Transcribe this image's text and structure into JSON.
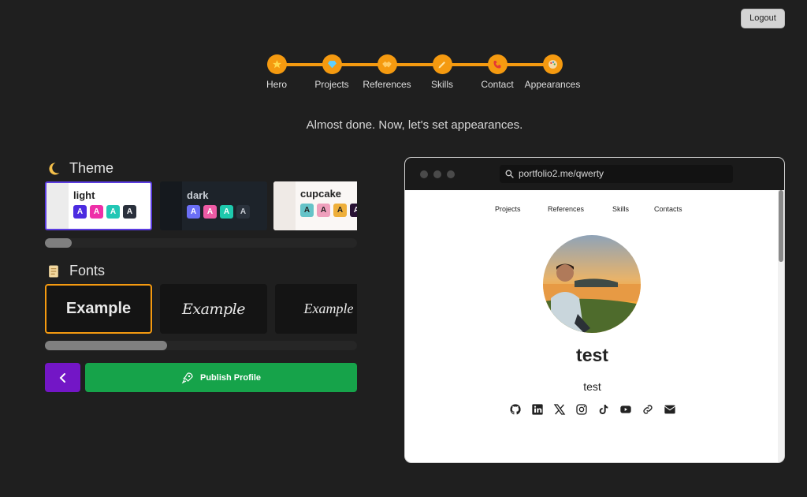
{
  "header": {
    "logout_label": "Logout"
  },
  "stepper": {
    "steps": [
      {
        "label": "Hero",
        "icon": "star-icon"
      },
      {
        "label": "Projects",
        "icon": "gem-icon"
      },
      {
        "label": "References",
        "icon": "handshake-icon"
      },
      {
        "label": "Skills",
        "icon": "pencil-icon"
      },
      {
        "label": "Contact",
        "icon": "phone-icon"
      },
      {
        "label": "Appearances",
        "icon": "palette-icon"
      }
    ],
    "accent": "#f59a10"
  },
  "headline": "Almost done. Now, let's set appearances.",
  "theme": {
    "title": "Theme",
    "icon": "moon-icon",
    "cards": [
      {
        "name": "light",
        "selected": true,
        "swatch_letter": "A"
      },
      {
        "name": "dark",
        "selected": false,
        "swatch_letter": "A"
      },
      {
        "name": "cupcake",
        "selected": false,
        "swatch_letter": "A"
      }
    ]
  },
  "fonts": {
    "title": "Fonts",
    "icon": "scroll-icon",
    "cards": [
      {
        "sample": "Example",
        "selected": true
      },
      {
        "sample": "Example",
        "selected": false
      },
      {
        "sample": "Example",
        "selected": false
      }
    ]
  },
  "actions": {
    "back_icon": "chevron-left-icon",
    "publish_label": "Publish Profile",
    "publish_icon": "rocket-icon",
    "back_color": "#7316c6",
    "publish_color": "#16a34a"
  },
  "preview": {
    "url": "portfolio2.me/qwerty",
    "nav": [
      "Projects",
      "References",
      "Skills",
      "Contacts"
    ],
    "name": "test",
    "subtitle": "test",
    "socials": [
      "github-icon",
      "linkedin-icon",
      "x-icon",
      "instagram-icon",
      "tiktok-icon",
      "youtube-icon",
      "link-icon",
      "email-icon"
    ]
  }
}
